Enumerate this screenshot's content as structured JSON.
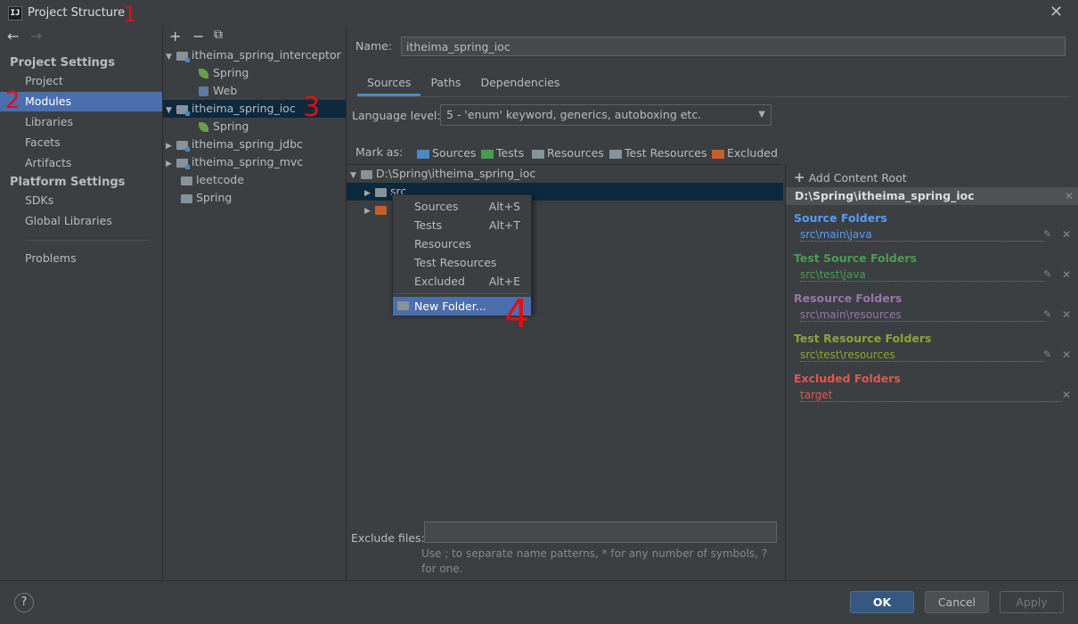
{
  "window": {
    "title": "Project Structure",
    "logo": "IJ"
  },
  "nav": {
    "back": "←",
    "forward": "→",
    "project_settings": "Project Settings",
    "project_items": [
      "Project",
      "Modules",
      "Libraries",
      "Facets",
      "Artifacts"
    ],
    "platform_settings": "Platform Settings",
    "platform_items": [
      "SDKs",
      "Global Libraries"
    ],
    "problems": "Problems",
    "selected": "Modules"
  },
  "modules_toolbar": {
    "add": "+",
    "remove": "−",
    "copy": "⧉"
  },
  "modules_tree": [
    {
      "label": "itheima_spring_interceptor",
      "type": "module",
      "expanded": true
    },
    {
      "label": "Spring",
      "type": "facet-spring"
    },
    {
      "label": "Web",
      "type": "facet-web"
    },
    {
      "label": "itheima_spring_ioc",
      "type": "module",
      "expanded": true,
      "selected": true
    },
    {
      "label": "Spring",
      "type": "facet-spring"
    },
    {
      "label": "itheima_spring_jdbc",
      "type": "module",
      "expanded": false
    },
    {
      "label": "itheima_spring_mvc",
      "type": "module",
      "expanded": false
    },
    {
      "label": "leetcode",
      "type": "module-plain"
    },
    {
      "label": "Spring",
      "type": "module-plain"
    }
  ],
  "main": {
    "name_label": "Name:",
    "name_value": "itheima_spring_ioc",
    "tabs": [
      "Sources",
      "Paths",
      "Dependencies"
    ],
    "active_tab": "Sources",
    "language_level_label": "Language level:",
    "language_level_value": "5 - 'enum' keyword, generics, autoboxing etc.",
    "mark_as_label": "Mark as:",
    "mark_buttons": [
      {
        "label": "Sources",
        "color": "#4a88c7"
      },
      {
        "label": "Tests",
        "color": "#499c54"
      },
      {
        "label": "Resources",
        "color": "#87939a"
      },
      {
        "label": "Test Resources",
        "color": "#87939a"
      },
      {
        "label": "Excluded",
        "color": "#c75e2c"
      }
    ],
    "root_path": "D:\\Spring\\itheima_spring_ioc",
    "src_folder": "src",
    "exclude_files_label": "Exclude files:",
    "exclude_hint": "Use ; to separate name patterns, * for any number of symbols, ? for one."
  },
  "context_menu": {
    "items": [
      {
        "label": "Sources",
        "shortcut": "Alt+S"
      },
      {
        "label": "Tests",
        "shortcut": "Alt+T"
      },
      {
        "label": "Resources",
        "shortcut": ""
      },
      {
        "label": "Test Resources",
        "shortcut": ""
      },
      {
        "label": "Excluded",
        "shortcut": "Alt+E"
      }
    ],
    "new_folder": "New Folder..."
  },
  "right_panel": {
    "add_content_root": "Add Content Root",
    "root": "D:\\Spring\\itheima_spring_ioc",
    "sections": [
      {
        "title": "Source Folders",
        "path": "src\\main\\java",
        "color": "#589df6",
        "editable": true
      },
      {
        "title": "Test Source Folders",
        "path": "src\\test\\java",
        "color": "#499c54",
        "editable": true
      },
      {
        "title": "Resource Folders",
        "path": "src\\main\\resources",
        "color": "#9876aa",
        "editable": true
      },
      {
        "title": "Test Resource Folders",
        "path": "src\\test\\resources",
        "color": "#8ba634",
        "editable": true
      },
      {
        "title": "Excluded Folders",
        "path": "target",
        "color": "#e05555",
        "editable": false
      }
    ]
  },
  "buttons": {
    "help": "?",
    "ok": "OK",
    "cancel": "Cancel",
    "apply": "Apply"
  },
  "annotations": [
    "1",
    "2",
    "3",
    "4"
  ]
}
